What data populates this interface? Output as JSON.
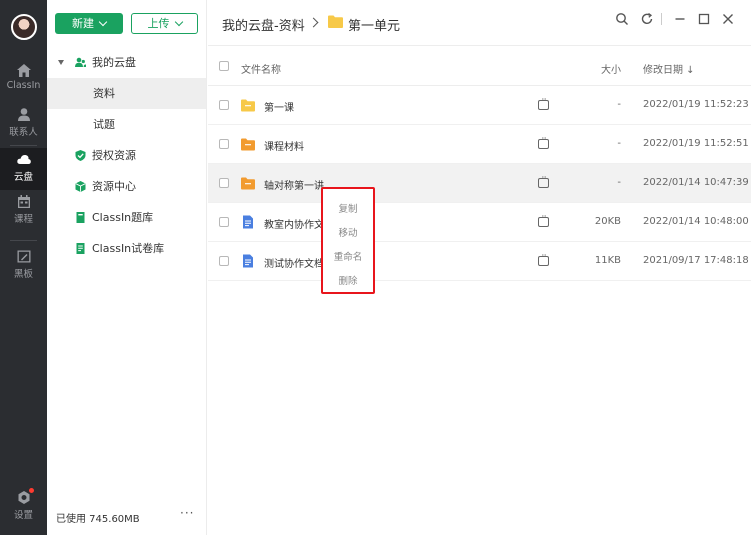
{
  "rail": {
    "items": [
      {
        "label": "ClassIn",
        "icon": "home-icon"
      },
      {
        "label": "联系人",
        "icon": "contacts-icon"
      },
      {
        "label": "云盘",
        "icon": "cloud-icon",
        "active": true
      },
      {
        "label": "课程",
        "icon": "calendar-icon"
      },
      {
        "label": "黑板",
        "icon": "blackboard-icon"
      }
    ],
    "settings_label": "设置"
  },
  "sidebar": {
    "new_label": "新建",
    "upload_label": "上传",
    "tree": [
      {
        "label": "我的云盘",
        "icon": "people-icon"
      },
      {
        "label": "资料",
        "selected": true
      },
      {
        "label": "试题"
      },
      {
        "label": "授权资源",
        "icon": "shield-icon"
      },
      {
        "label": "资源中心",
        "icon": "cube-icon"
      },
      {
        "label": "ClassIn题库",
        "icon": "book-icon"
      },
      {
        "label": "ClassIn试卷库",
        "icon": "paper-icon"
      }
    ],
    "usage": "已使用 745.60MB",
    "more": "···"
  },
  "header": {
    "crumb_root": "我的云盘-资料",
    "crumb_current": "第一单元"
  },
  "table": {
    "col_name": "文件名称",
    "col_size": "大小",
    "col_date": "修改日期 ↓",
    "rows": [
      {
        "name": "第一课",
        "type": "folder",
        "size": "-",
        "date": "2022/01/19 11:52:23"
      },
      {
        "name": "课程材料",
        "type": "folder-orange",
        "size": "-",
        "date": "2022/01/19 11:52:51"
      },
      {
        "name": "轴对称第一讲",
        "type": "folder-orange",
        "size": "-",
        "date": "2022/01/14 10:47:39"
      },
      {
        "name": "教室内协作文",
        "type": "doc",
        "size": "20KB",
        "date": "2022/01/14 10:48:00"
      },
      {
        "name": "测试协作文档",
        "type": "doc",
        "size": "11KB",
        "date": "2021/09/17 17:48:18"
      }
    ]
  },
  "context_menu": {
    "items": [
      "复制",
      "移动",
      "重命名",
      "删除"
    ]
  },
  "colors": {
    "accent": "#1aa260",
    "rail_bg": "#2b2d31",
    "folder_yellow": "#f7c948",
    "folder_orange": "#f29b2f",
    "doc_blue": "#4a7fe0",
    "highlight_red": "#e8151c"
  }
}
